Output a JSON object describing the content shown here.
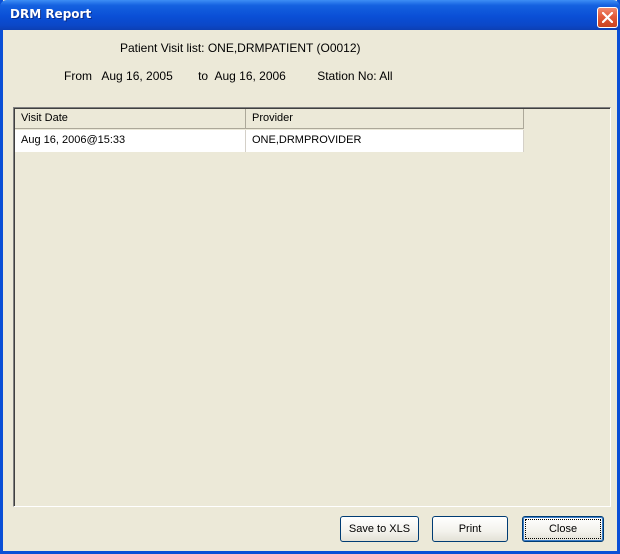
{
  "window": {
    "title": "DRM Report",
    "close_icon": "close-icon",
    "accent_color": "#0a4fd6",
    "close_color": "#e25a3a"
  },
  "header": {
    "patient_label": "Patient Visit list:",
    "patient_name": "ONE,DRMPATIENT (O0012)",
    "from_label": "From",
    "from_date": "Aug 16, 2005",
    "to_label": "to",
    "to_date": "Aug 16, 2006",
    "station_label": "Station No:",
    "station_value": "All"
  },
  "table": {
    "columns": [
      "Visit Date",
      "Provider"
    ],
    "rows": [
      {
        "visit_date": "Aug 16, 2006@15:33",
        "provider": "ONE,DRMPROVIDER"
      }
    ]
  },
  "buttons": {
    "save_xls": "Save to XLS",
    "print": "Print",
    "close": "Close"
  }
}
